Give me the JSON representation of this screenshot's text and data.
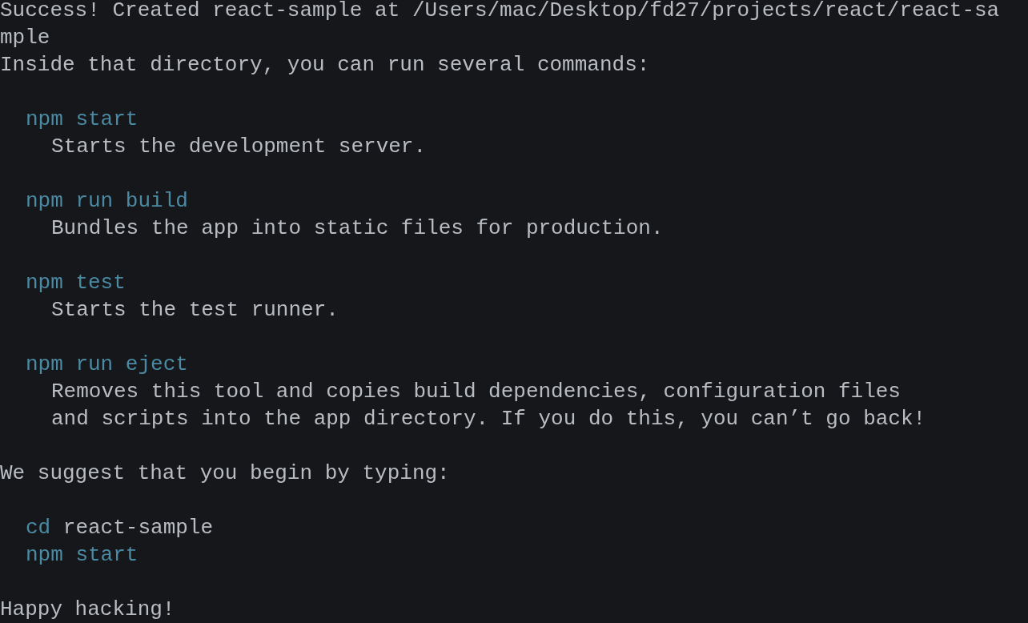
{
  "terminal": {
    "lines": [
      {
        "kind": "output",
        "text": "Success! Created react-sample at /Users/mac/Desktop/fd27/projects/react/react-sa"
      },
      {
        "kind": "output",
        "text": "mple"
      },
      {
        "kind": "output",
        "text": "Inside that directory, you can run several commands:"
      },
      {
        "kind": "blank"
      },
      {
        "kind": "command",
        "text": "npm start"
      },
      {
        "kind": "description",
        "text": "Starts the development server."
      },
      {
        "kind": "blank"
      },
      {
        "kind": "command",
        "text": "npm run build"
      },
      {
        "kind": "description",
        "text": "Bundles the app into static files for production."
      },
      {
        "kind": "blank"
      },
      {
        "kind": "command",
        "text": "npm test"
      },
      {
        "kind": "description",
        "text": "Starts the test runner."
      },
      {
        "kind": "blank"
      },
      {
        "kind": "command",
        "text": "npm run eject"
      },
      {
        "kind": "description",
        "text": "Removes this tool and copies build dependencies, configuration files"
      },
      {
        "kind": "description",
        "text": "and scripts into the app directory. If you do this, you can’t go back!"
      },
      {
        "kind": "blank"
      },
      {
        "kind": "output",
        "text": "We suggest that you begin by typing:"
      },
      {
        "kind": "blank"
      },
      {
        "kind": "command",
        "text": "cd",
        "argument": "react-sample"
      },
      {
        "kind": "command",
        "text": "npm start"
      },
      {
        "kind": "blank"
      },
      {
        "kind": "output",
        "text": "Happy hacking!"
      }
    ]
  }
}
